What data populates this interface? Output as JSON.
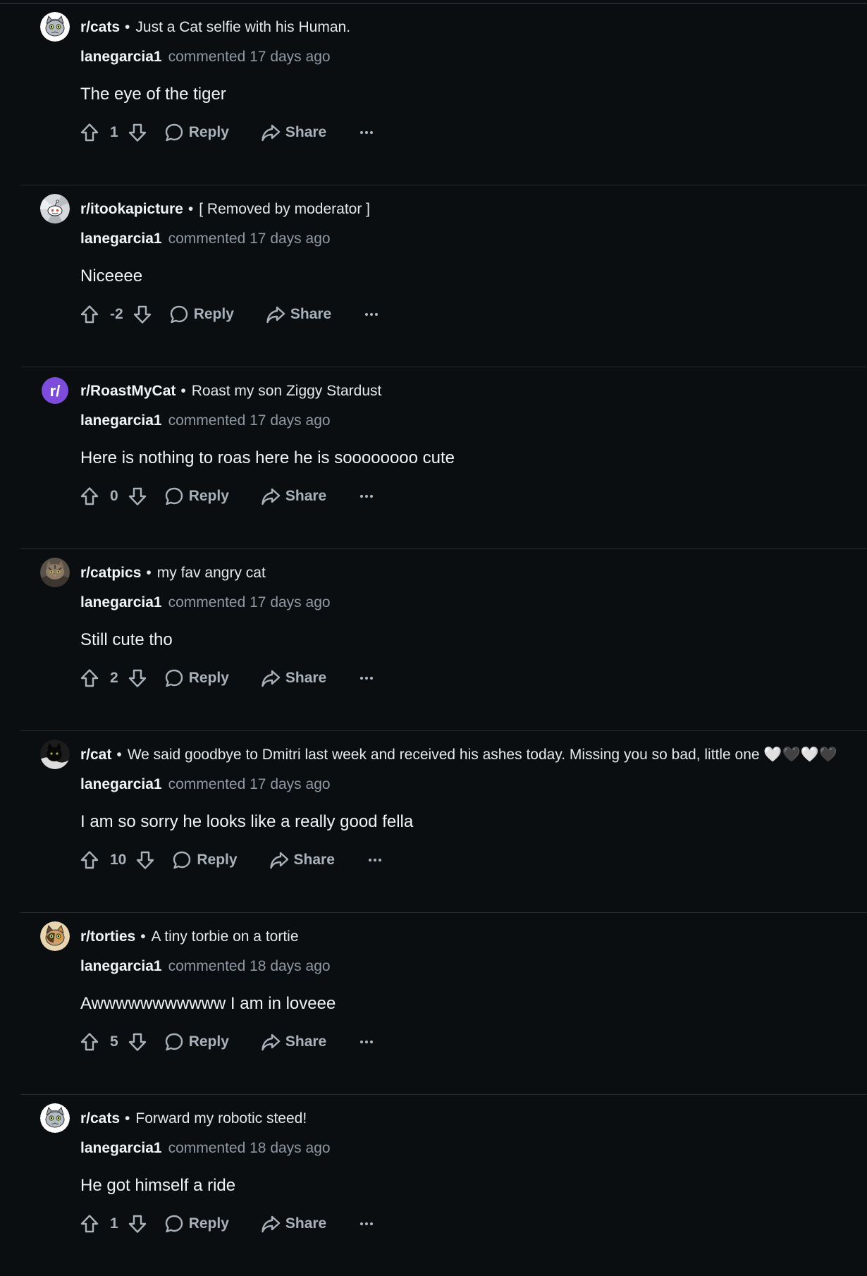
{
  "colors": {
    "background": "#0b0e11",
    "divider": "#262b30",
    "text_primary": "#f2f3f5",
    "text_muted": "#8f98a3",
    "action_text": "#a9b2bb",
    "roastmycat_avatar": "#7d4cdb"
  },
  "icons": {
    "upvote": "arrow-up-outline-icon",
    "downvote": "arrow-down-outline-icon",
    "reply": "speech-bubble-icon",
    "share": "share-arrow-icon",
    "more": "ellipsis-icon"
  },
  "comments": [
    {
      "subreddit": "r/cats",
      "post_title": "Just a Cat selfie with his Human.",
      "user": "lanegarcia1",
      "when": "commented 17 days ago",
      "text": "The eye of the tiger",
      "score": "1",
      "reply_label": "Reply",
      "share_label": "Share",
      "avatar": "cat-cartoon-avatar"
    },
    {
      "subreddit": "r/itookapicture",
      "post_title": "[ Removed by moderator ]",
      "user": "lanegarcia1",
      "when": "commented 17 days ago",
      "text": "Niceeee",
      "score": "-2",
      "reply_label": "Reply",
      "share_label": "Share",
      "avatar": "snoo-camera-avatar"
    },
    {
      "subreddit": "r/RoastMyCat",
      "post_title": "Roast my son Ziggy Stardust",
      "user": "lanegarcia1",
      "when": "commented 17 days ago",
      "text": "Here is nothing to roas here he is soooooooo cute",
      "score": "0",
      "reply_label": "Reply",
      "share_label": "Share",
      "avatar": "default-subreddit-avatar",
      "avatar_text": "r/"
    },
    {
      "subreddit": "r/catpics",
      "post_title": "my fav angry cat",
      "user": "lanegarcia1",
      "when": "commented 17 days ago",
      "text": "Still cute tho",
      "score": "2",
      "reply_label": "Reply",
      "share_label": "Share",
      "avatar": "tabby-photo-avatar"
    },
    {
      "subreddit": "r/cat",
      "post_title": "We said goodbye to Dmitri last week and received his ashes today. Missing you so bad, little one 🤍🖤🤍🖤",
      "user": "lanegarcia1",
      "when": "commented 17 days ago",
      "text": "I am so sorry he looks like a really good fella",
      "score": "10",
      "reply_label": "Reply",
      "share_label": "Share",
      "avatar": "black-cat-avatar"
    },
    {
      "subreddit": "r/torties",
      "post_title": "A tiny torbie on a tortie",
      "user": "lanegarcia1",
      "when": "commented 18 days ago",
      "text": "Awwwwwwwwwww I am in loveee",
      "score": "5",
      "reply_label": "Reply",
      "share_label": "Share",
      "avatar": "tortie-cartoon-avatar"
    },
    {
      "subreddit": "r/cats",
      "post_title": "Forward my robotic steed!",
      "user": "lanegarcia1",
      "when": "commented 18 days ago",
      "text": "He got himself a ride",
      "score": "1",
      "reply_label": "Reply",
      "share_label": "Share",
      "avatar": "cat-cartoon-avatar"
    }
  ]
}
